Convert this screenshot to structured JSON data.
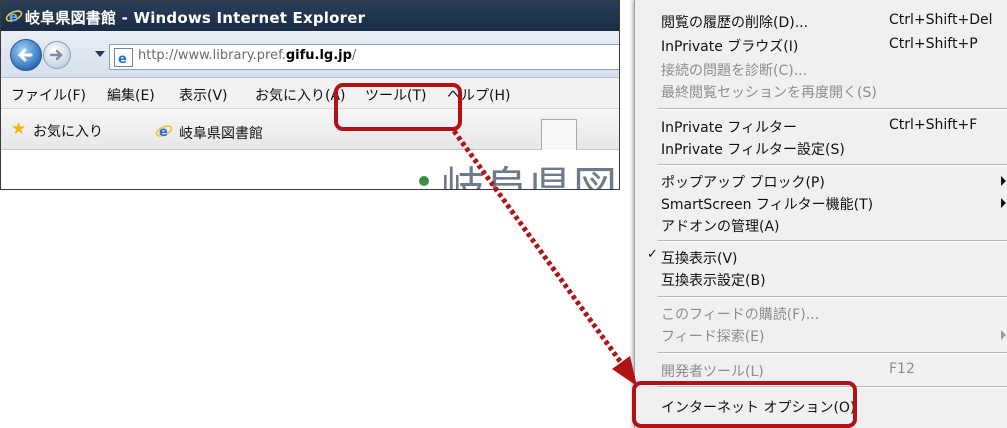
{
  "browser": {
    "title": "岐阜県図書館 - Windows Internet Explorer",
    "url_prefix": "http://www.library.pref.",
    "url_host": "gifu.lg.jp",
    "url_suffix": "/"
  },
  "menubar": {
    "file": "ファイル(F)",
    "edit": "編集(E)",
    "view": "表示(V)",
    "favorites": "お気に入り(A)",
    "tools": "ツール(T)",
    "help": "ヘルプ(H)"
  },
  "favorites_bar": {
    "label": "お気に入り",
    "tab_title": "岐阜県図書館"
  },
  "page_content": {
    "heading_fragment": "岐阜県図"
  },
  "tools_menu": {
    "items": [
      {
        "label": "閲覧の履歴の削除(D)...",
        "shortcut": "Ctrl+Shift+Del",
        "enabled": true
      },
      {
        "label": "InPrivate ブラウズ(I)",
        "shortcut": "Ctrl+Shift+P",
        "enabled": true
      },
      {
        "label": "接続の問題を診断(C)...",
        "shortcut": "",
        "enabled": false
      },
      {
        "label": "最終閲覧セッションを再度開く(S)",
        "shortcut": "",
        "enabled": false
      },
      {
        "label": "InPrivate フィルター",
        "shortcut": "Ctrl+Shift+F",
        "enabled": true
      },
      {
        "label": "InPrivate フィルター設定(S)",
        "shortcut": "",
        "enabled": true
      },
      {
        "label": "ポップアップ ブロック(P)",
        "shortcut": "",
        "enabled": true,
        "submenu": true
      },
      {
        "label": "SmartScreen フィルター機能(T)",
        "shortcut": "",
        "enabled": true,
        "submenu": true
      },
      {
        "label": "アドオンの管理(A)",
        "shortcut": "",
        "enabled": true
      },
      {
        "label": "互換表示(V)",
        "shortcut": "",
        "enabled": true,
        "checked": true
      },
      {
        "label": "互換表示設定(B)",
        "shortcut": "",
        "enabled": true
      },
      {
        "label": "このフィードの購読(F)...",
        "shortcut": "",
        "enabled": false
      },
      {
        "label": "フィード探索(E)",
        "shortcut": "",
        "enabled": false,
        "submenu": true
      },
      {
        "label": "開発者ツール(L)",
        "shortcut": "F12",
        "enabled": false
      },
      {
        "label": "インターネット オプション(O)",
        "shortcut": "",
        "enabled": true
      }
    ]
  },
  "colors": {
    "highlight": "#b11216",
    "titlebar": "#1f3350",
    "menu_bg": "#f0f0f0",
    "disabled_text": "#8d8d8d"
  },
  "icons": {
    "back": "back-arrow-icon",
    "forward": "forward-arrow-icon",
    "page": "ie-page-icon",
    "favorites": "star-icon",
    "ie": "ie-logo-icon"
  }
}
